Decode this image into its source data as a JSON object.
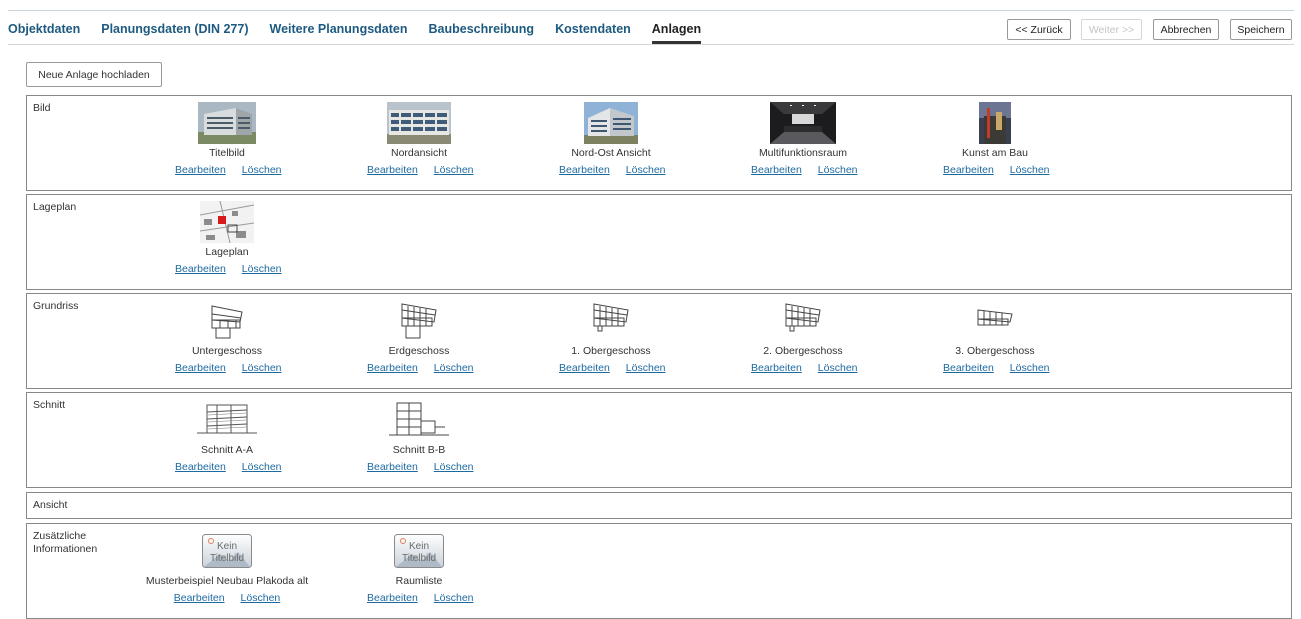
{
  "tabs": [
    {
      "label": "Objektdaten",
      "active": false
    },
    {
      "label": "Planungsdaten (DIN 277)",
      "active": false
    },
    {
      "label": "Weitere Planungsdaten",
      "active": false
    },
    {
      "label": "Baubeschreibung",
      "active": false
    },
    {
      "label": "Kostendaten",
      "active": false
    },
    {
      "label": "Anlagen",
      "active": true
    }
  ],
  "toolbar": {
    "back_label": "<< Zurück",
    "next_label": "Weiter >>",
    "cancel_label": "Abbrechen",
    "save_label": "Speichern"
  },
  "upload_label": "Neue Anlage hochladen",
  "actions": {
    "edit": "Bearbeiten",
    "delete": "Löschen"
  },
  "placeholder": {
    "line1": "Kein",
    "line2": "Titelbild"
  },
  "sections": {
    "bild": {
      "label": "Bild",
      "items": [
        {
          "caption": "Titelbild",
          "thumb": "building-photo-icon"
        },
        {
          "caption": "Nordansicht",
          "thumb": "facade-photo-icon"
        },
        {
          "caption": "Nord-Ost Ansicht",
          "thumb": "building-photo-icon"
        },
        {
          "caption": "Multifunktionsraum",
          "thumb": "hall-photo-icon"
        },
        {
          "caption": "Kunst am Bau",
          "thumb": "artwork-photo-icon"
        }
      ]
    },
    "lageplan": {
      "label": "Lageplan",
      "items": [
        {
          "caption": "Lageplan",
          "thumb": "site-plan-icon"
        }
      ]
    },
    "grundriss": {
      "label": "Grundriss",
      "items": [
        {
          "caption": "Untergeschoss",
          "thumb": "floor-plan-icon"
        },
        {
          "caption": "Erdgeschoss",
          "thumb": "floor-plan-icon"
        },
        {
          "caption": "1. Obergeschoss",
          "thumb": "floor-plan-icon"
        },
        {
          "caption": "2. Obergeschoss",
          "thumb": "floor-plan-icon"
        },
        {
          "caption": "3. Obergeschoss",
          "thumb": "floor-plan-icon"
        }
      ]
    },
    "schnitt": {
      "label": "Schnitt",
      "items": [
        {
          "caption": "Schnitt A-A",
          "thumb": "section-drawing-icon"
        },
        {
          "caption": "Schnitt B-B",
          "thumb": "section-drawing-icon"
        }
      ]
    },
    "ansicht": {
      "label": "Ansicht",
      "items": []
    },
    "zusatz": {
      "label": "Zusätzliche Informationen",
      "items": [
        {
          "caption": "Musterbeispiel Neubau Plakoda alt",
          "thumb": "no-image-icon"
        },
        {
          "caption": "Raumliste",
          "thumb": "no-image-icon"
        }
      ]
    }
  },
  "colors": {
    "link": "#1d6aa0",
    "tab": "#1d5a80",
    "border": "#888888"
  }
}
